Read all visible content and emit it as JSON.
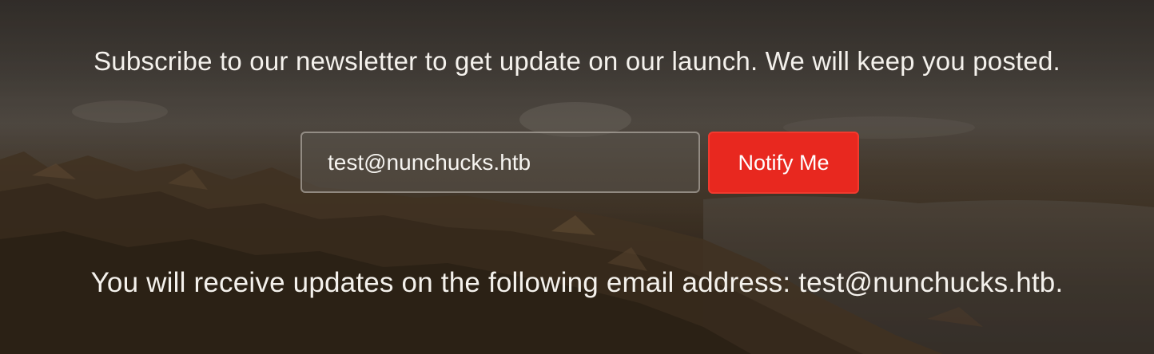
{
  "newsletter": {
    "intro_text": "Subscribe to our newsletter to get update on our launch. We will keep you posted.",
    "email_value": "test@nunchucks.htb",
    "notify_button_label": "Notify Me",
    "result_text": "You will receive updates on the following email address: test@nunchucks.htb."
  },
  "colors": {
    "accent": "#e8281f",
    "text": "#f4f1ec"
  }
}
